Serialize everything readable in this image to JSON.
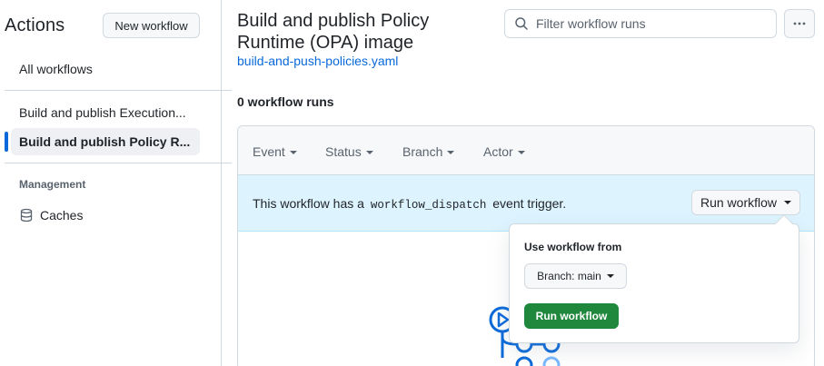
{
  "sidebar": {
    "title": "Actions",
    "new_workflow_label": "New workflow",
    "items": [
      {
        "label": "All workflows"
      },
      {
        "label": "Build and publish Execution..."
      },
      {
        "label": "Build and publish Policy R..."
      }
    ],
    "management_heading": "Management",
    "caches_label": "Caches"
  },
  "main": {
    "title": "Build and publish Policy Runtime (OPA) image",
    "file_link": "build-and-push-policies.yaml",
    "search_placeholder": "Filter workflow runs",
    "run_count": "0 workflow runs",
    "filters": [
      "Event",
      "Status",
      "Branch",
      "Actor"
    ],
    "banner": {
      "text_before": "This workflow has a",
      "code": "workflow_dispatch",
      "text_after": "event trigger.",
      "button_label": "Run workflow"
    }
  },
  "popover": {
    "label": "Use workflow from",
    "branch_button": "Branch: main",
    "run_button": "Run workflow"
  },
  "colors": {
    "accent": "#0969da",
    "banner_bg": "#ddf4ff",
    "primary_button": "#1f883d",
    "border": "#d1d9e0"
  },
  "icons": [
    "search-icon",
    "kebab-icon",
    "database-icon",
    "workflow-illustration-icon"
  ]
}
